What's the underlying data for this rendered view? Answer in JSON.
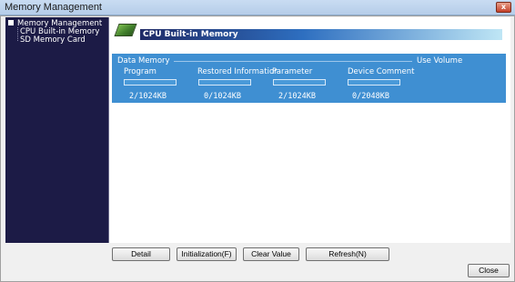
{
  "window": {
    "title": "Memory Management",
    "close_glyph": "x"
  },
  "tree": {
    "root": "Memory Management",
    "children": [
      "CPU Built-in Memory",
      "SD Memory Card"
    ]
  },
  "header": {
    "title": "CPU Built-in Memory",
    "icon": "memory-chip-icon"
  },
  "data_memory": {
    "title": "Data Memory",
    "use_volume_label": "Use Volume",
    "columns": [
      {
        "label": "Program",
        "value": "2/1024KB"
      },
      {
        "label": "Restored Informatior",
        "value": "0/1024KB"
      },
      {
        "label": "Parameter",
        "value": "2/1024KB"
      },
      {
        "label": "Device Comment",
        "value": "0/2048KB"
      }
    ]
  },
  "buttons": {
    "detail": "Detail",
    "initialization": "Initialization(F)",
    "clear_value": "Clear Value",
    "refresh": "Refresh(N)",
    "close": "Close"
  },
  "colors": {
    "panel_background": "#1c1b46",
    "data_memory_background": "#3f8fd2"
  }
}
